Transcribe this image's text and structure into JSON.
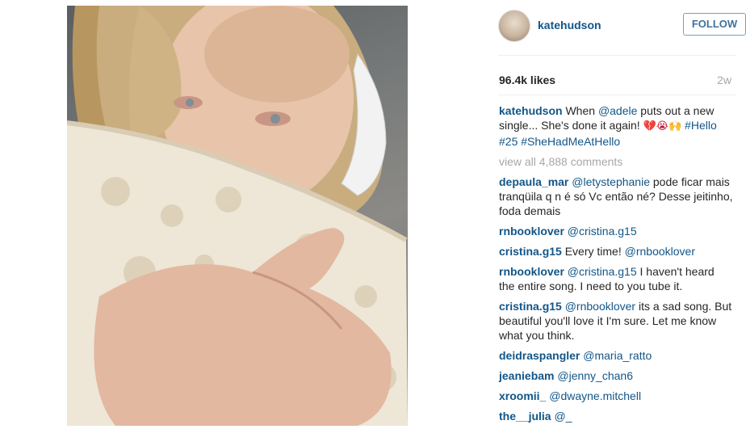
{
  "post": {
    "username": "katehudson",
    "follow_label": "FOLLOW",
    "likes": "96.4k likes",
    "age": "2w"
  },
  "caption": {
    "username": "katehudson",
    "text1": "When ",
    "mention": "@adele",
    "text2": " puts out a new single... She's done it again! ",
    "emojis": "💔😭🙌",
    "hashtags": "#Hello #25 #SheHadMeAtHello"
  },
  "view_all": "view all 4,888 comments",
  "comments": [
    {
      "user": "depaula_mar",
      "mention": "@letystephanie",
      "text": " pode ficar mais tranqüila q n é só Vc então né? Desse jeitinho, foda demais"
    },
    {
      "user": "rnbooklover",
      "mention": "@cristina.g15",
      "text": ""
    },
    {
      "user": "cristina.g15",
      "mention": "",
      "text": "Every time! ",
      "mention2": "@rnbooklover"
    },
    {
      "user": "rnbooklover",
      "mention": "@cristina.g15",
      "text": " I haven't heard the entire song. I need to you tube it."
    },
    {
      "user": "cristina.g15",
      "mention": "@rnbooklover",
      "text": " its a sad song. But beautiful you'll love it I'm sure. Let me know what you think."
    },
    {
      "user": "deidraspangler",
      "mention": "@maria_ratto",
      "text": ""
    },
    {
      "user": "jeaniebam",
      "mention": "@jenny_chan6",
      "text": ""
    },
    {
      "user": "xroomii_",
      "mention": "@dwayne.mitchell",
      "text": ""
    },
    {
      "user": "the__julia",
      "mention": "@_",
      "text": ""
    }
  ]
}
